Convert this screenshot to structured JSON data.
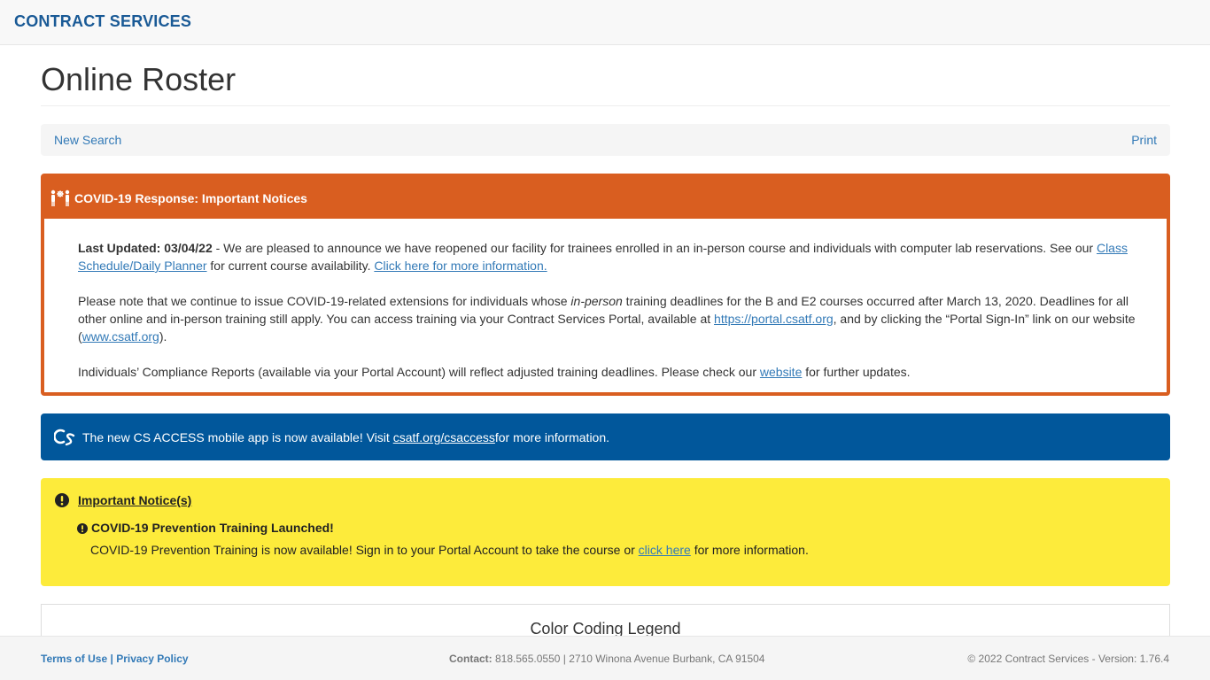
{
  "header": {
    "brand": "CONTRACT SERVICES"
  },
  "page": {
    "title": "Online Roster"
  },
  "nav": {
    "new_search": "New Search",
    "print": "Print"
  },
  "covid": {
    "heading": "COVID-19 Response: Important Notices",
    "p1_label": "Last Updated: 03/04/22",
    "p1_text": " - We are pleased to announce we have reopened our facility for trainees enrolled in an in-person course and individuals with computer lab reservations. See our ",
    "p1_link1": "Class Schedule/Daily Planner",
    "p1_text2": " for current course availability. ",
    "p1_link2": "Click here for more information.",
    "p2_text1": "Please note that we continue to issue COVID-19-related extensions for individuals whose ",
    "p2_em": "in-person",
    "p2_text2": " training deadlines for the B and E2 courses occurred after March 13, 2020. Deadlines for all other online and in-person training still apply. You can access training via your Contract Services Portal, available at ",
    "p2_link1": "https://portal.csatf.org",
    "p2_text3": ", and by clicking the “Portal Sign-In” link on our website (",
    "p2_link2": "www.csatf.org",
    "p2_text4": ").",
    "p3_text1": "Individuals’ Compliance Reports (available via your Portal Account) will reflect adjusted training deadlines. Please check our ",
    "p3_link": "website",
    "p3_text2": " for further updates."
  },
  "cs_access": {
    "text1": "The new CS ACCESS mobile app is now available! Visit ",
    "link": "csatf.org/csaccess",
    "text2": " for more information."
  },
  "notice": {
    "title": "Important Notice(s)",
    "item_title": "COVID-19 Prevention Training Launched!",
    "text1": "COVID-19 Prevention Training is now available! Sign in to your Portal Account to take the course or ",
    "link": "click here",
    "text2": " for more information."
  },
  "legend": {
    "title": "Color Coding Legend"
  },
  "footer": {
    "terms": "Terms of Use",
    "separator": "|",
    "privacy": "Privacy Policy",
    "contact_label": "Contact:",
    "contact_text": " 818.565.0550 | 2710 Winona Avenue Burbank, CA 91504",
    "copyright": "© 2022 Contract Services - Version: 1.76.4"
  },
  "colors": {
    "brand": "#1a5a96",
    "covid_orange": "#d95e20",
    "cs_blue": "#01579b",
    "notice_yellow": "#fdeb3b",
    "link": "#337ab7"
  }
}
